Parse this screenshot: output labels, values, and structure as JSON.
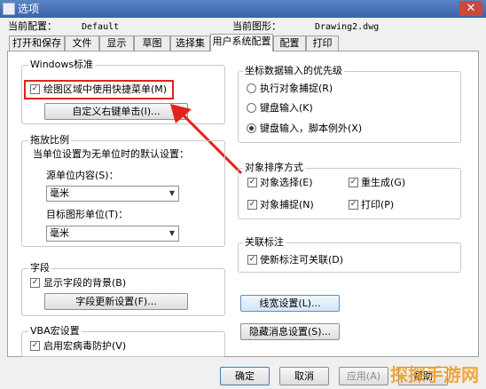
{
  "window": {
    "title": "选项",
    "close_glyph": "✕"
  },
  "profile": {
    "current_config_label": "当前配置：",
    "current_config_value": "Default",
    "current_drawing_label": "当前图形：",
    "current_drawing_value": "Drawing2.dwg"
  },
  "tabs": [
    "打开和保存",
    "文件",
    "显示",
    "草图",
    "选择集",
    "用户系统配置",
    "配置",
    "打印"
  ],
  "active_tab": "用户系统配置",
  "windows_std": {
    "title": "Windows标准",
    "shortcut_menu_label": "绘图区域中使用快捷菜单(M)",
    "shortcut_menu_checked": true,
    "right_click_button": "自定义右键单击(I)..."
  },
  "scaling": {
    "title": "拖放比例",
    "description": "当单位设置为无单位时的默认设置：",
    "source_label": "源单位内容(S)：",
    "source_value": "毫米",
    "target_label": "目标图形单位(T)：",
    "target_value": "毫米"
  },
  "fields": {
    "title": "字段",
    "show_bg_label": "显示字段的背景(B)",
    "show_bg_checked": true,
    "update_button": "字段更新设置(F)..."
  },
  "vba": {
    "title": "VBA宏设置",
    "virus_label": "启用宏病毒防护(V)",
    "virus_checked": true
  },
  "coord_priority": {
    "title": "坐标数据输入的优先级",
    "options": [
      "执行对象捕捉(R)",
      "键盘输入(K)",
      "键盘输入，脚本例外(X)"
    ],
    "selected": "键盘输入，脚本例外(X)"
  },
  "object_sort": {
    "title": "对象排序方式",
    "items": [
      {
        "label": "对象选择(E)",
        "checked": true
      },
      {
        "label": "重生成(G)",
        "checked": true
      },
      {
        "label": "对象捕捉(N)",
        "checked": true
      },
      {
        "label": "打印(P)",
        "checked": true
      }
    ]
  },
  "assoc_dim": {
    "title": "关联标注",
    "label": "使新标注可关联(D)",
    "checked": true
  },
  "lineweight_button": "线宽设置(L)...",
  "hidden_msg_button": "隐藏消息设置(S)...",
  "footer": {
    "ok": "确定",
    "cancel": "取消",
    "apply": "应用(A)",
    "help": "帮助"
  },
  "watermark": "探探手游网",
  "colors": {
    "annotation_red": "#e2231a",
    "titlebar_blue": "#3a62a8"
  }
}
